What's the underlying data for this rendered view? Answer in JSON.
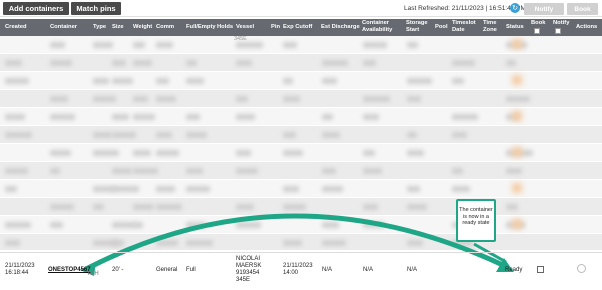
{
  "toolbar": {
    "add_containers": "Add containers",
    "match_pins": "Match pins",
    "last_refreshed": "Last Refreshed:  21/11/2023 | 16:51:49 PM",
    "notify": "Notify",
    "book": "Book"
  },
  "columns": [
    "Created",
    "Container",
    "Type",
    "Size",
    "Weight",
    "Comm",
    "Full/Empty",
    "Holds",
    "Vessel",
    "Pin",
    "Exp Cutoff",
    "Est Discharge",
    "Container Availability",
    "Storage Start",
    "Pool",
    "Timeslot Date",
    "Time Zone",
    "Status",
    "Book",
    "Notify",
    "Actions"
  ],
  "row": {
    "created": "21/11/2023 16:18:44",
    "container": "ONESTOP4567",
    "type_suffix": "rCH",
    "size": "20' -",
    "comm": "General",
    "full_empty": "Full",
    "vessel": "NICOLAI MAERSK 9193454 345E",
    "exp_cutoff": "21/11/2023 14:00",
    "est_discharge": "N/A",
    "container_availability": "N/A",
    "storage_start": "N/A",
    "status": "Ready"
  },
  "faded_vessel_text": "345E",
  "callout": "The container is now in a ready state",
  "colors": {
    "accent": "#1fa687",
    "header_bg": "#666a70",
    "toolbar_btn": "#4a4a4a",
    "refresh_icon": "#3aa0d8"
  }
}
